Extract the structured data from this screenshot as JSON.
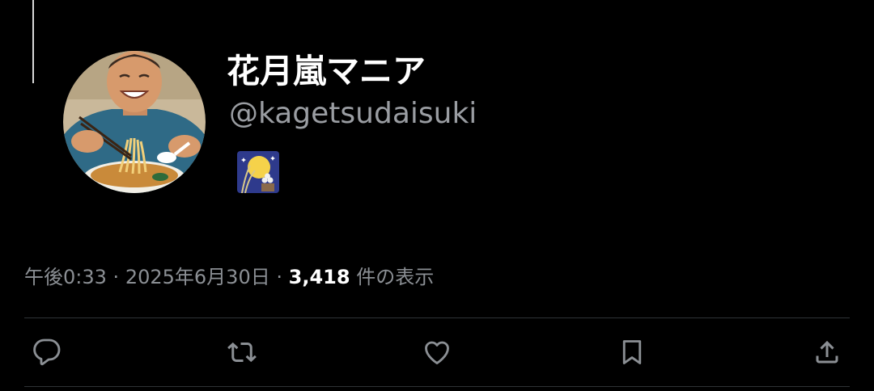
{
  "profile": {
    "display_name": "花月嵐マニア",
    "handle": "@kagetsudaisuki",
    "bio_emoji": "moon-viewing-ceremony-emoji"
  },
  "meta": {
    "time": "午後0:33",
    "separator_1": "·",
    "date": "2025年6月30日",
    "separator_2": "·",
    "views_count": "3,418",
    "views_label": "件の表示"
  },
  "actions": [
    {
      "name": "reply",
      "icon": "reply-icon"
    },
    {
      "name": "retweet",
      "icon": "retweet-icon"
    },
    {
      "name": "like",
      "icon": "heart-icon"
    },
    {
      "name": "bookmark",
      "icon": "bookmark-icon"
    },
    {
      "name": "share",
      "icon": "share-icon"
    }
  ],
  "colors": {
    "background": "#000000",
    "primary_text": "#ffffff",
    "secondary_text": "#8b8f94",
    "divider": "#2f3336",
    "icon": "#8b8f94"
  }
}
